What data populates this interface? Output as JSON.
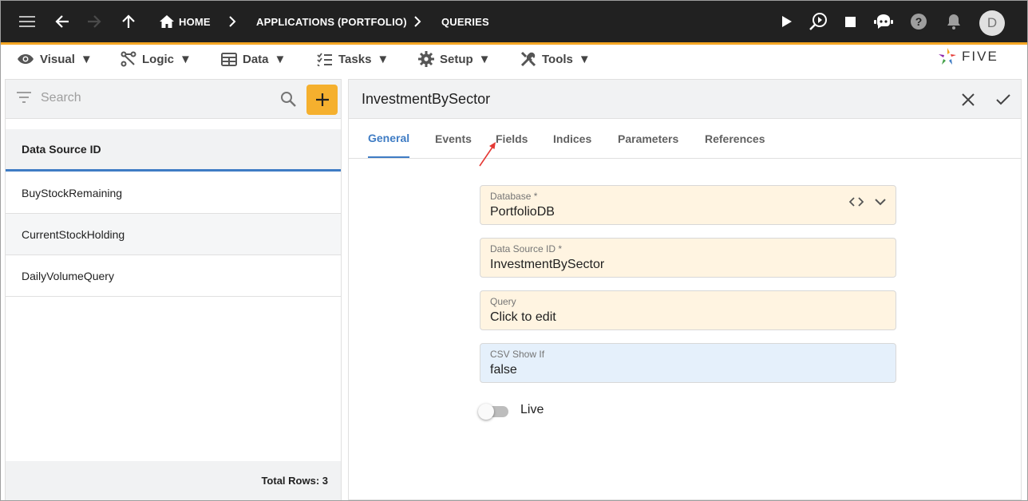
{
  "appbar": {
    "breadcrumbs": [
      "HOME",
      "APPLICATIONS (PORTFOLIO)",
      "QUERIES"
    ],
    "avatar_initial": "D"
  },
  "menubar": {
    "items": [
      {
        "label": "Visual",
        "icon": "eye-icon"
      },
      {
        "label": "Logic",
        "icon": "logic-icon"
      },
      {
        "label": "Data",
        "icon": "table-icon"
      },
      {
        "label": "Tasks",
        "icon": "checklist-icon"
      },
      {
        "label": "Setup",
        "icon": "gear-icon"
      },
      {
        "label": "Tools",
        "icon": "tools-icon"
      }
    ],
    "dropdown_glyph": "▼",
    "logo_text": "FIVE"
  },
  "list": {
    "search_placeholder": "Search",
    "column_header": "Data Source ID",
    "rows": [
      "BuyStockRemaining",
      "CurrentStockHolding",
      "DailyVolumeQuery"
    ],
    "footer": "Total Rows: 3"
  },
  "form": {
    "title": "InvestmentBySector",
    "tabs": [
      "General",
      "Events",
      "Fields",
      "Indices",
      "Parameters",
      "References"
    ],
    "active_tab": "General",
    "fields": [
      {
        "label": "Database *",
        "value": "PortfolioDB"
      },
      {
        "label": "Data Source ID *",
        "value": "InvestmentBySector"
      },
      {
        "label": "Query",
        "value": "Click to edit"
      },
      {
        "label": "CSV Show If",
        "value": "false"
      }
    ],
    "toggle_label": "Live",
    "toggle_on": false
  },
  "colors": {
    "appbar_bg": "#212121",
    "accent": "#f5a623",
    "active_tab": "#3f7cc4",
    "required_field_bg": "#fff4e1",
    "optional_field_bg": "#e5f0fb",
    "annotation_arrow": "#e53935"
  }
}
